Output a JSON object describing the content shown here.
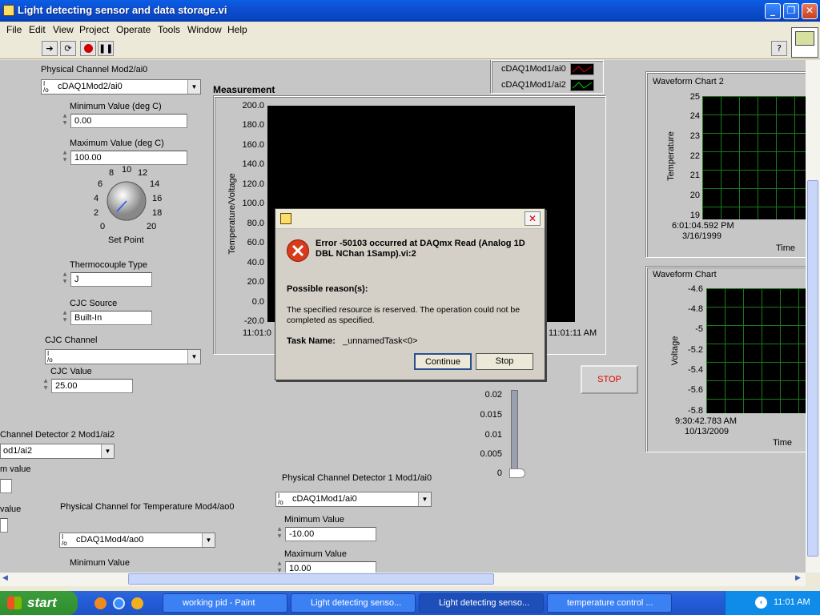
{
  "window": {
    "title": "Light detecting sensor and data storage.vi"
  },
  "menu": [
    "File",
    "Edit",
    "View",
    "Project",
    "Operate",
    "Tools",
    "Window",
    "Help"
  ],
  "left": {
    "phys_ch_mod2_label": "Physical Channel Mod2/ai0",
    "phys_ch_mod2_value": "cDAQ1Mod2/ai0",
    "min_label": "Minimum Value (deg C)",
    "min_value": "0.00",
    "max_label": "Maximum Value (deg C)",
    "max_value": "100.00",
    "knob_ticks": [
      "0",
      "2",
      "4",
      "6",
      "8",
      "10",
      "12",
      "14",
      "16",
      "18",
      "20"
    ],
    "setpoint_label": "Set Point",
    "tc_type_label": "Thermocouple Type",
    "tc_type_value": "J",
    "cjc_source_label": "CJC Source",
    "cjc_source_value": "Built-In",
    "cjc_channel_label": "CJC Channel",
    "cjc_value_label": "CJC Value",
    "cjc_value": "25.00",
    "det2_label": "Channel Detector 2  Mod1/ai2",
    "det2_value": "od1/ai2",
    "cut_value1": "m value",
    "cut_value2": "value",
    "temp_ch_label": "Physical Channel for Temperature Mod4/ao0",
    "temp_ch_value": "cDAQ1Mod4/ao0",
    "min_value_label": "Minimum Value"
  },
  "measurement": {
    "title": "Measurement",
    "ylabel": "Temperature/Voltage",
    "yticks": [
      "200.0",
      "180.0",
      "160.0",
      "140.0",
      "120.0",
      "100.0",
      "80.0",
      "60.0",
      "40.0",
      "20.0",
      "0.0",
      "-20.0"
    ],
    "x_start": "11:01:0",
    "x_end": "11:01:11 AM",
    "legend": [
      "cDAQ1Mod1/ai0",
      "cDAQ1Mod1/ai2"
    ]
  },
  "chart_data": [
    {
      "type": "line",
      "title": "Measurement",
      "ylabel": "Temperature/Voltage",
      "ylim": [
        -20,
        200
      ],
      "series": [
        {
          "name": "cDAQ1Mod1/ai0",
          "values": []
        },
        {
          "name": "cDAQ1Mod1/ai2",
          "values": []
        }
      ]
    },
    {
      "type": "line",
      "title": "Waveform Chart 2",
      "ylabel": "Temperature",
      "xlabel": "Time",
      "ylim": [
        19,
        25
      ],
      "series": []
    },
    {
      "type": "line",
      "title": "Waveform Chart",
      "ylabel": "Voltage",
      "xlabel": "Time",
      "ylim": [
        -5.8,
        -4.6
      ],
      "series": []
    }
  ],
  "slider": {
    "ticks": [
      "0.02",
      "0.015",
      "0.01",
      "0.005",
      "0"
    ],
    "level": 0
  },
  "stop_label": "STOP",
  "det1": {
    "label": "Physical Channel Detector 1 Mod1/ai0",
    "value": "cDAQ1Mod1/ai0",
    "min_label": "Minimum Value",
    "min_value": "-10.00",
    "max_label": "Maximum Value",
    "max_value": "10.00"
  },
  "wf2": {
    "title": "Waveform Chart 2",
    "ylabel": "Temperature",
    "yticks": [
      "25",
      "24",
      "23",
      "22",
      "21",
      "20",
      "19"
    ],
    "time1": "6:01:04.592 PM",
    "time2": "3/16/1999",
    "xlabel": "Time"
  },
  "wf1": {
    "title": "Waveform Chart",
    "ylabel": "Voltage",
    "yticks": [
      "-4.6",
      "-4.8",
      "-5",
      "-5.2",
      "-5.4",
      "-5.6",
      "-5.8"
    ],
    "time1": "9:30:42.783 AM",
    "time2": "10/13/2009",
    "xlabel": "Time"
  },
  "dialog": {
    "error_title": "Error -50103 occurred at DAQmx Read (Analog 1D DBL NChan 1Samp).vi:2",
    "reasons_label": "Possible reason(s):",
    "message": "The specified resource is reserved. The operation could not be completed as specified.",
    "task_label": "Task Name:",
    "task_value": "_unnamedTask<0>",
    "continue": "Continue",
    "stop": "Stop"
  },
  "taskbar": {
    "start": "start",
    "tasks": [
      "working pid - Paint",
      "Light detecting senso...",
      "Light detecting senso...",
      "temperature control ..."
    ],
    "clock": "11:01 AM"
  },
  "colors": {
    "error_red": "#d83a1c",
    "stop_red": "#e00000",
    "grid_green": "#1a7a1a"
  }
}
